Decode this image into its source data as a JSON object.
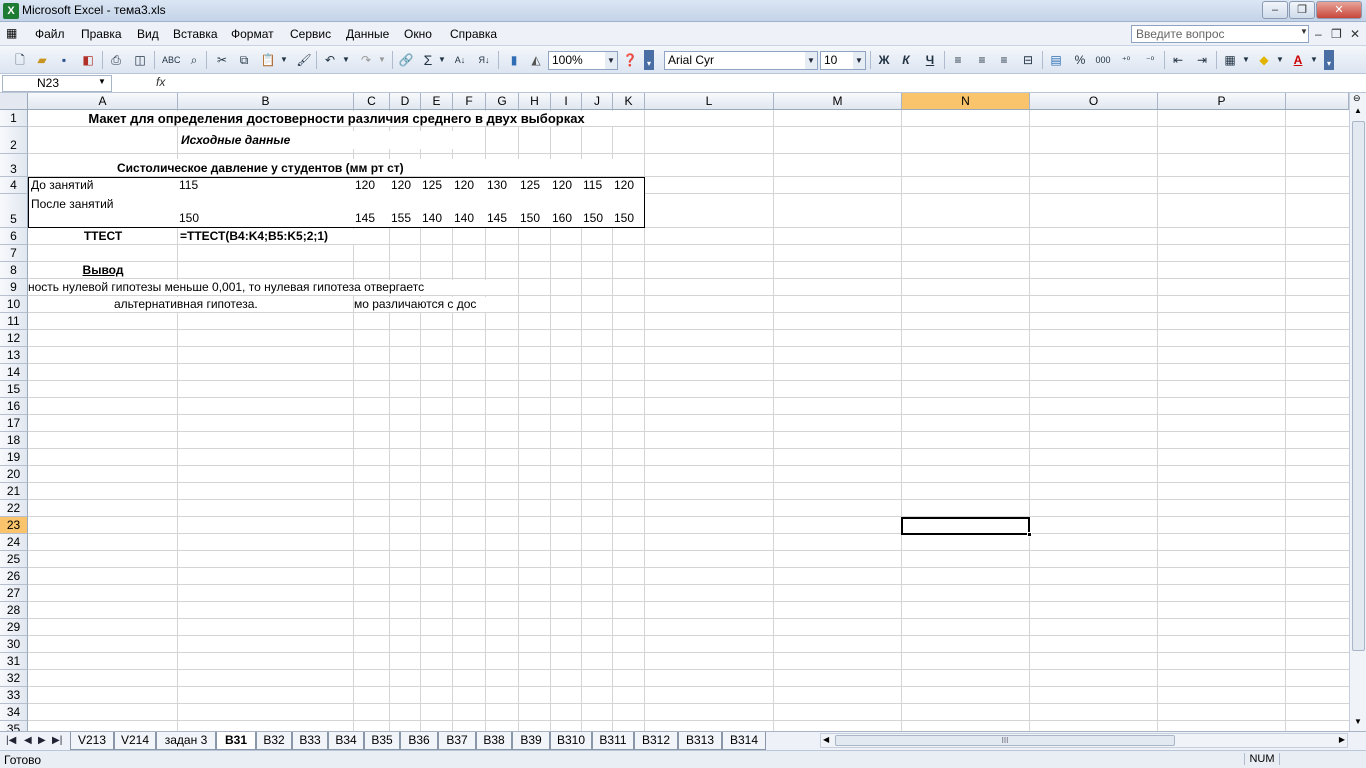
{
  "window": {
    "title": "Microsoft Excel - тема3.xls",
    "app_icon": "X"
  },
  "menu": [
    "Файл",
    "Правка",
    "Вид",
    "Вставка",
    "Формат",
    "Сервис",
    "Данные",
    "Окно",
    "Справка"
  ],
  "help_placeholder": "Введите вопрос",
  "toolbar": {
    "zoom": "100%",
    "font": "Arial Cyr",
    "font_size": "10",
    "bold": "Ж",
    "italic": "К",
    "underline": "Ч",
    "sum": "Σ",
    "percent": "%",
    "thousands": "000"
  },
  "formula_bar": {
    "name_box": "N23",
    "fx": "fx",
    "formula": ""
  },
  "columns": [
    "A",
    "B",
    "C",
    "D",
    "E",
    "F",
    "G",
    "H",
    "I",
    "J",
    "K",
    "L",
    "M",
    "N",
    "O",
    "P"
  ],
  "rows": [
    "1",
    "2",
    "3",
    "4",
    "5",
    "6",
    "7",
    "8",
    "9",
    "10",
    "11",
    "12",
    "13",
    "14",
    "15",
    "16",
    "17",
    "18",
    "19",
    "20",
    "21",
    "22",
    "23",
    "24",
    "25",
    "26",
    "27",
    "28",
    "29",
    "30",
    "31",
    "32",
    "33",
    "34",
    "35"
  ],
  "selected_cell": "N23",
  "sheet": {
    "title": "Макет для определения достоверности различия среднего в двух выборках",
    "subtitle": "Исходные данные",
    "table_title": "Систолическое давление у студентов (мм рт ст)",
    "row4_label": "До занятий",
    "row4_values": [
      "115",
      "120",
      "120",
      "125",
      "120",
      "130",
      "125",
      "120",
      "115",
      "120"
    ],
    "row5_label": "После занятий",
    "row5_values": [
      "150",
      "145",
      "155",
      "140",
      "140",
      "145",
      "150",
      "160",
      "150",
      "150"
    ],
    "ttest_label": "ТТЕСТ",
    "ttest_formula": "=ТТЕСТ(B4:K4;B5:K5;2;1)",
    "conclusion_label": "Вывод",
    "row9_text": "ность нулевой гипотезы меньше 0,001, то нулевая гипотеза отвергаетс",
    "row10_text_a": "альтернативная гипотеза.",
    "row10_text_b": "мо различаются с дос"
  },
  "sheet_tabs": [
    "V213",
    "V214",
    "задан 3",
    "В31",
    "В32",
    "В33",
    "В34",
    "В35",
    "В36",
    "В37",
    "В38",
    "В39",
    "В310",
    "В311",
    "В312",
    "В313",
    "В314"
  ],
  "active_tab": "В31",
  "hscroll_thumb": "III",
  "status": {
    "text": "Готово",
    "num": "NUM"
  }
}
